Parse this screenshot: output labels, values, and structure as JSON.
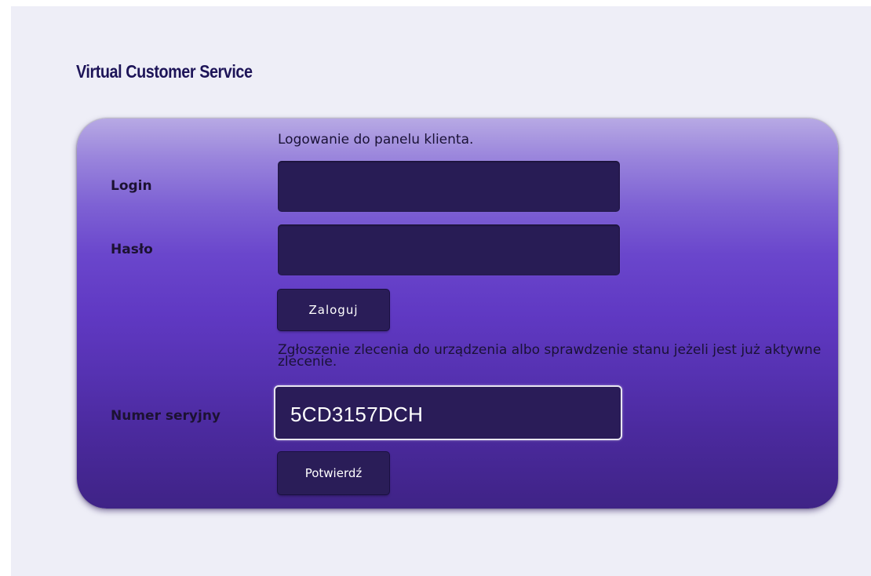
{
  "header": {
    "title": "Virtual Customer Service"
  },
  "login_panel": {
    "intro": "Logowanie do panelu klienta.",
    "login_label": "Login",
    "login_value": "",
    "password_label": "Hasło",
    "password_value": "",
    "submit_label": "Zaloguj"
  },
  "serial_panel": {
    "info": "Zgłoszenie zlecenia do urządzenia albo sprawdzenie stanu jeżeli jest już aktywne zlecenie.",
    "serial_label": "Numer seryjny",
    "serial_value": "5CD3157DCH",
    "confirm_label": "Potwierdź"
  },
  "colors": {
    "page_background": "#eeeef7",
    "title": "#1d1458",
    "panel_top": "#b7a9e4",
    "panel_mid": "#6039c3",
    "panel_bottom": "#3f2386",
    "field_background": "#281c55"
  }
}
